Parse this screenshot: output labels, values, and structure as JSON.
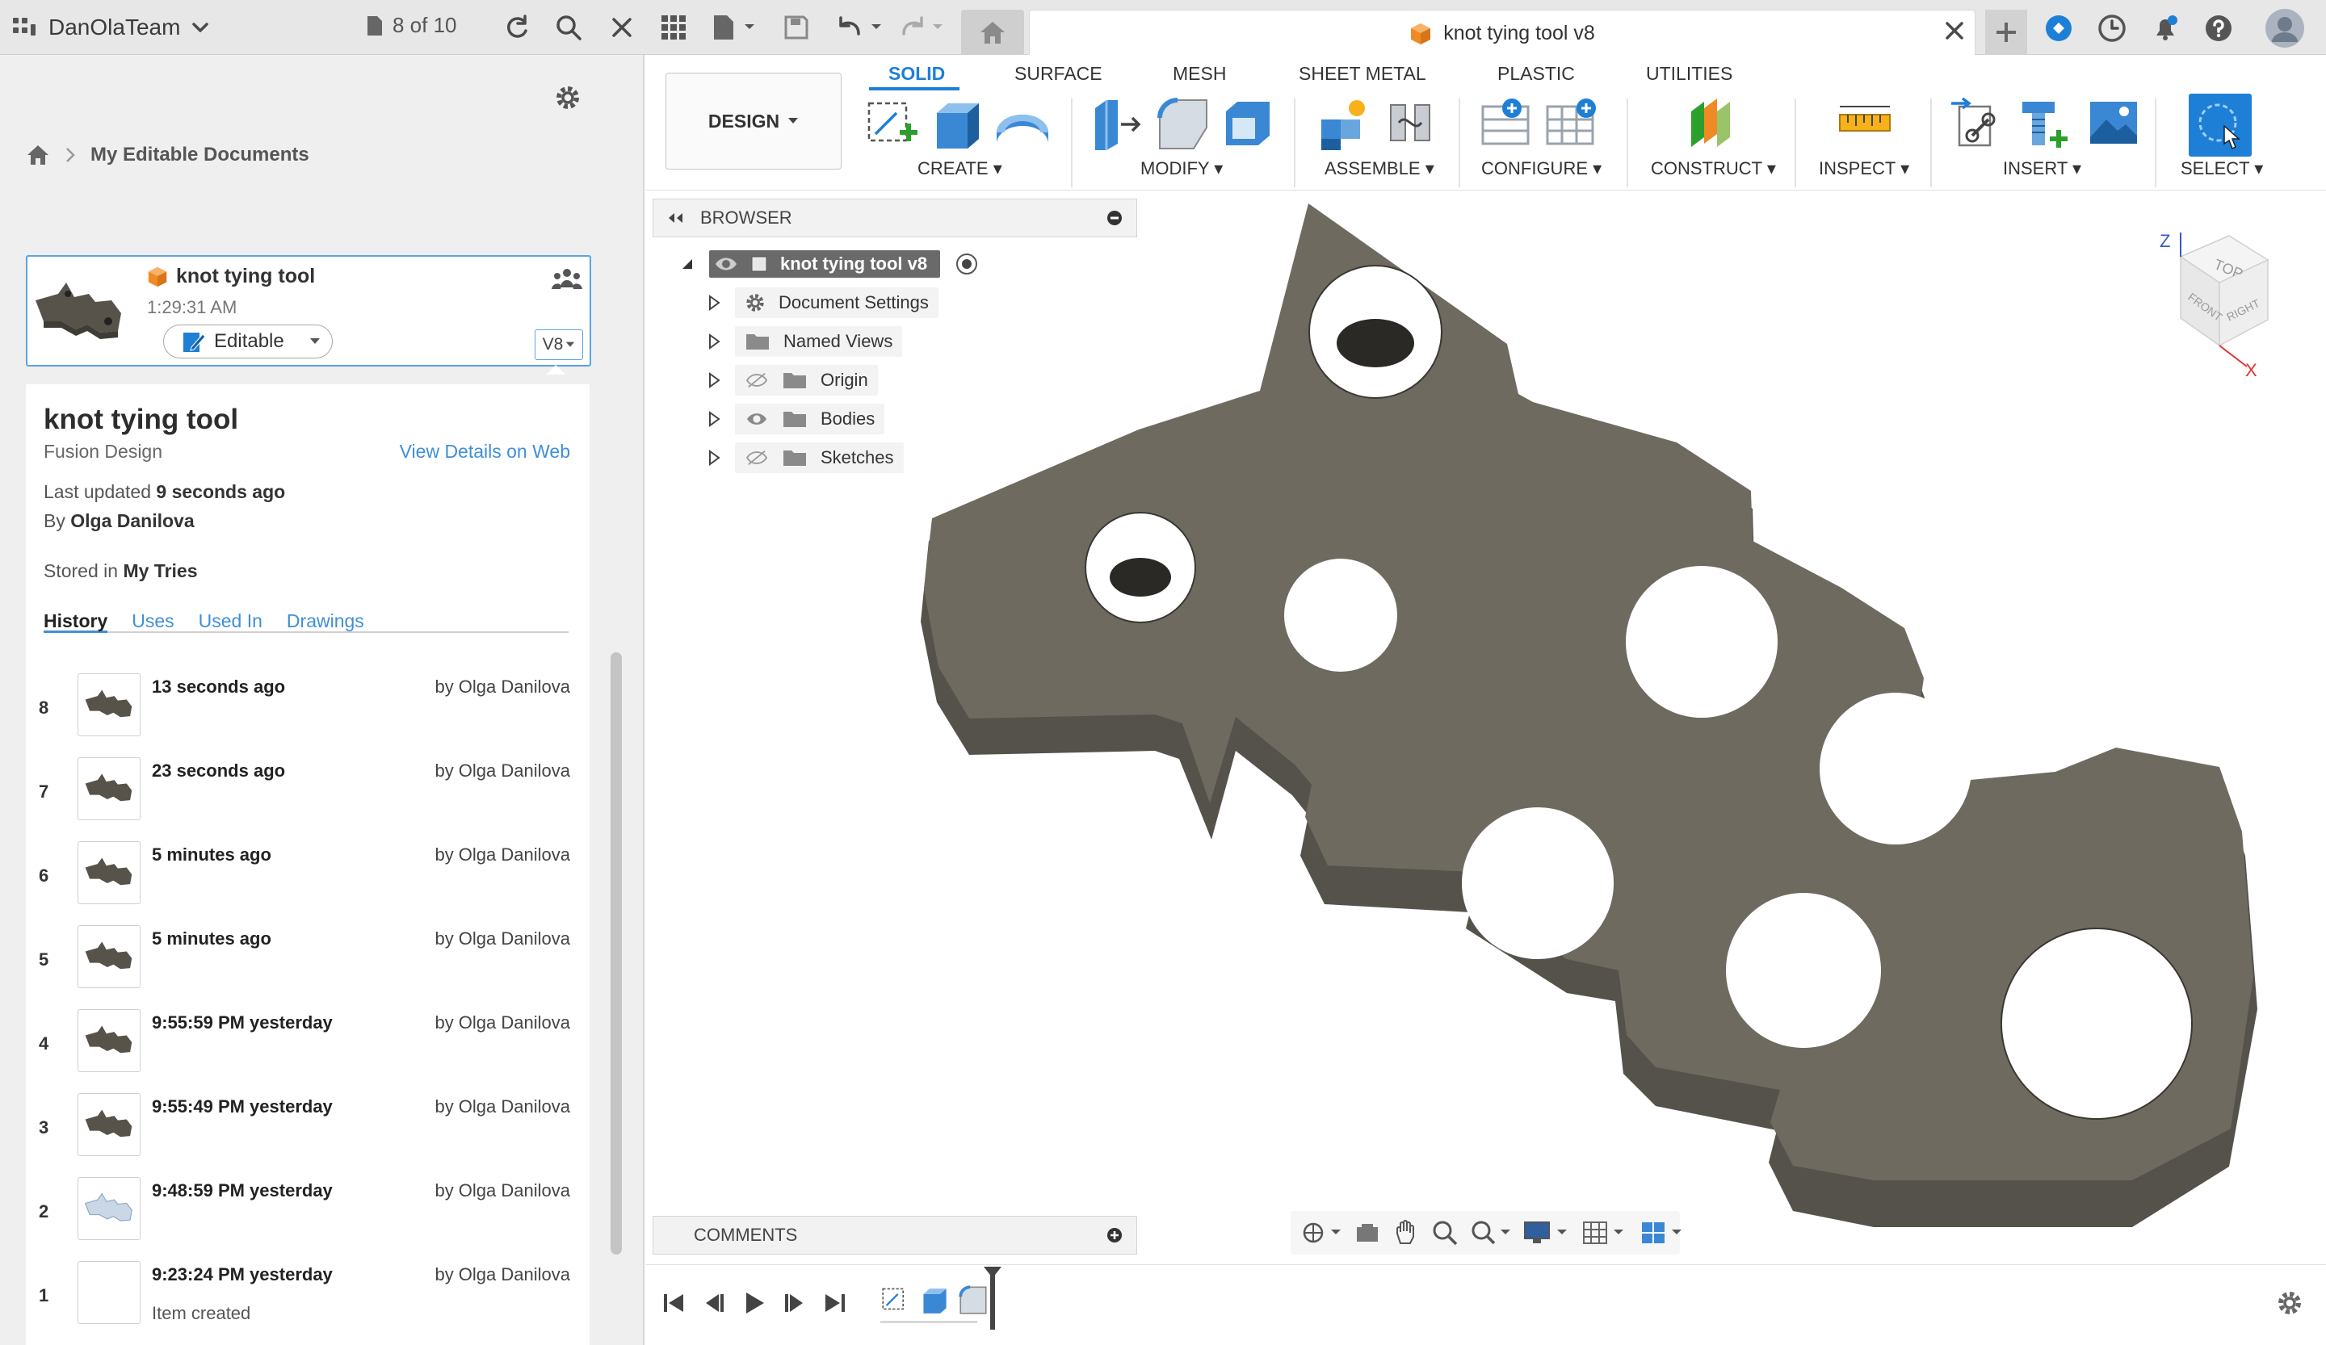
{
  "topbar": {
    "team_name": "DanOlaTeam",
    "doc_count": "8 of 10",
    "tab_title": "knot tying tool v8"
  },
  "left_panel": {
    "breadcrumb": "My Editable Documents",
    "card": {
      "title": "knot tying tool",
      "time": "1:29:31 AM",
      "status": "Editable",
      "version": "V8"
    },
    "details": {
      "title": "knot tying tool",
      "subtitle": "Fusion Design",
      "view_link": "View Details on Web",
      "updated_label": "Last updated",
      "updated_value": "9 seconds ago",
      "by_label": "By",
      "by_value": "Olga Danilova",
      "stored_label": "Stored in",
      "stored_value": "My Tries"
    },
    "tabs": [
      "History",
      "Uses",
      "Used In",
      "Drawings"
    ],
    "history": [
      {
        "num": "8",
        "time": "13 seconds ago",
        "by": "by Olga Danilova",
        "sub": ""
      },
      {
        "num": "7",
        "time": "23 seconds ago",
        "by": "by Olga Danilova",
        "sub": ""
      },
      {
        "num": "6",
        "time": "5 minutes ago",
        "by": "by Olga Danilova",
        "sub": ""
      },
      {
        "num": "5",
        "time": "5 minutes ago",
        "by": "by Olga Danilova",
        "sub": ""
      },
      {
        "num": "4",
        "time": "9:55:59 PM yesterday",
        "by": "by Olga Danilova",
        "sub": ""
      },
      {
        "num": "3",
        "time": "9:55:49 PM yesterday",
        "by": "by Olga Danilova",
        "sub": ""
      },
      {
        "num": "2",
        "time": "9:48:59 PM yesterday",
        "by": "by Olga Danilova",
        "sub": ""
      },
      {
        "num": "1",
        "time": "9:23:24 PM yesterday",
        "by": "by Olga Danilova",
        "sub": "Item created"
      }
    ]
  },
  "toolbar": {
    "design_label": "DESIGN",
    "tabs": [
      "SOLID",
      "SURFACE",
      "MESH",
      "SHEET METAL",
      "PLASTIC",
      "UTILITIES"
    ],
    "groups": [
      "CREATE",
      "MODIFY",
      "ASSEMBLE",
      "CONFIGURE",
      "CONSTRUCT",
      "INSPECT",
      "INSERT",
      "SELECT"
    ]
  },
  "browser": {
    "header": "BROWSER",
    "root": "knot tying tool v8",
    "items": [
      "Document Settings",
      "Named Views",
      "Origin",
      "Bodies",
      "Sketches"
    ]
  },
  "viewcube": {
    "top": "TOP",
    "front": "FRONT",
    "right": "RIGHT",
    "z": "Z",
    "x": "X"
  },
  "comments_label": "COMMENTS",
  "colors": {
    "accent": "#1e7fd6",
    "model": "#6f6b61",
    "model_top": "#6e6a60"
  }
}
